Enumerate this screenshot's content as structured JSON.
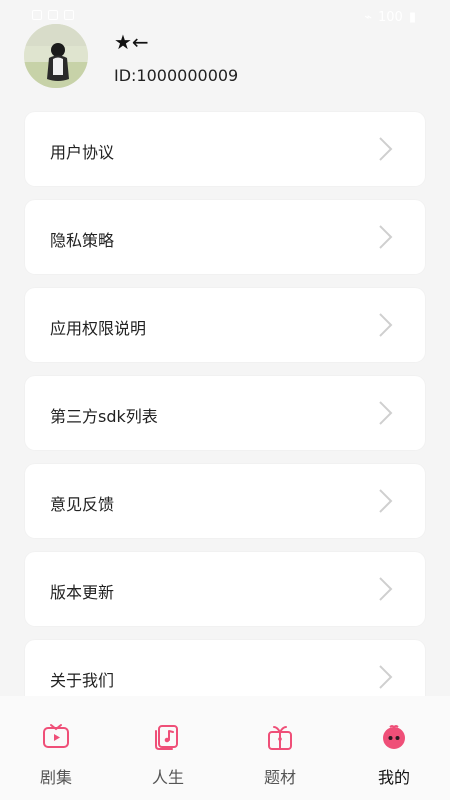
{
  "status_bar": {
    "time": "",
    "battery": "100"
  },
  "profile": {
    "nickname": "★←",
    "user_id": "ID:1000000009"
  },
  "menu": {
    "items": [
      {
        "label": "用户协议"
      },
      {
        "label": "隐私策略"
      },
      {
        "label": "应用权限说明"
      },
      {
        "label": "第三方sdk列表"
      },
      {
        "label": "意见反馈"
      },
      {
        "label": "版本更新"
      },
      {
        "label": "关于我们"
      }
    ]
  },
  "bottom_nav": {
    "items": [
      {
        "label": "剧集",
        "icon": "tv-icon"
      },
      {
        "label": "人生",
        "icon": "music-cards-icon"
      },
      {
        "label": "题材",
        "icon": "gift-box-icon"
      },
      {
        "label": "我的",
        "icon": "profile-face-icon",
        "active": true
      }
    ]
  },
  "colors": {
    "accent": "#ef4f78",
    "background": "#f5f5f5",
    "card": "#ffffff"
  }
}
